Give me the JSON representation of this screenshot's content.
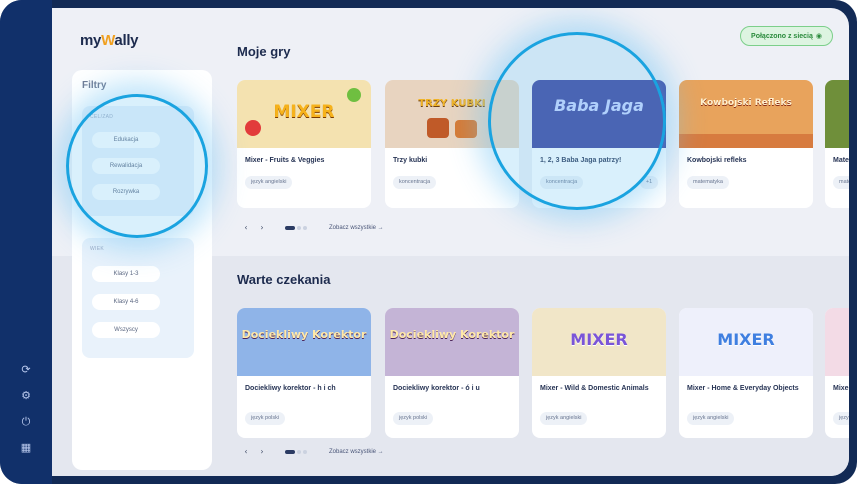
{
  "app": {
    "logo_prefix": "my",
    "logo_w": "W",
    "logo_suffix": "ally"
  },
  "status": {
    "label": "Połączono z siecią",
    "icon": "wifi-icon"
  },
  "filters": {
    "title": "Filtry",
    "group1": {
      "label": "CEL/ZAD",
      "buttons": [
        "Edukacja",
        "Rewalidacja",
        "Rozrywka"
      ]
    },
    "group2": {
      "label": "WIEK",
      "buttons": [
        "Klasy 1-3",
        "Klasy 4-6",
        "Wszyscy"
      ]
    }
  },
  "rail_icons": [
    "refresh-icon",
    "settings-icon",
    "power-icon",
    "grid-icon"
  ],
  "sections": {
    "my_games": {
      "title": "Moje gry",
      "cards": [
        {
          "art": "MIXER",
          "title": "Mixer - Fruits & Veggies",
          "tag": "język angielski"
        },
        {
          "art": "TRZY KUBKI",
          "title": "Trzy kubki",
          "tag": "koncentracja"
        },
        {
          "art": "Baba Jaga",
          "title": "1, 2, 3 Baba Jaga patrzy!",
          "tag": "koncentracja",
          "more": "+1"
        },
        {
          "art": "Kowbojski Refleks",
          "title": "Kowbojski refleks",
          "tag": "matematyka"
        },
        {
          "art": "",
          "title": "Mate",
          "tag": "mate"
        }
      ],
      "see_all": "Zobacz wszystkie →"
    },
    "worth_waiting": {
      "title": "Warte czekania",
      "cards": [
        {
          "art": "Dociekliwy Korektor",
          "title": "Dociekliwy korektor - h i ch",
          "tag": "język polski"
        },
        {
          "art": "Dociekliwy Korektor",
          "title": "Dociekliwy korektor - ó i u",
          "tag": "język polski"
        },
        {
          "art": "MIXER",
          "title": "Mixer - Wild & Domestic Animals",
          "tag": "język angielski"
        },
        {
          "art": "MIXER",
          "title": "Mixer - Home & Everyday Objects",
          "tag": "język angielski"
        },
        {
          "art": "",
          "title": "Mixe Acce",
          "tag": "język"
        }
      ],
      "see_all": "Zobacz wszystkie →"
    }
  },
  "pager": {
    "prev": "‹",
    "next": "›"
  },
  "colors": {
    "accent": "#1aa3e0",
    "rail": "#11306a",
    "title": "#1d2b4e"
  }
}
